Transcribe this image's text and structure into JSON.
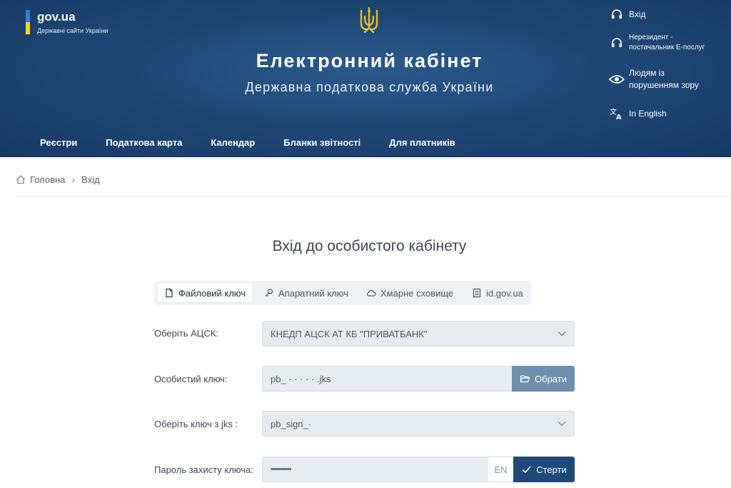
{
  "header": {
    "gov_brand": "gov.ua",
    "gov_subtitle": "Державні сайти України",
    "title": "Електронний кабінет",
    "subtitle": "Державна податкова служба України",
    "right_links": {
      "login": "Вхід",
      "nonresident_line1": "Нерезидент -",
      "nonresident_line2": "постачальник Е-послуг",
      "vision_line1": "Людям із",
      "vision_line2": "порушенням зору",
      "english": "In English"
    },
    "nav": [
      "Реєстри",
      "Податкова карта",
      "Календар",
      "Бланки звітності",
      "Для платників"
    ]
  },
  "breadcrumb": {
    "home": "Головна",
    "current": "Вхід"
  },
  "page_title": "Вхід до особистого кабінету",
  "tabs": [
    "Файловий ключ",
    "Апаратний ключ",
    "Хмарне сховище",
    "id.gov.ua"
  ],
  "form": {
    "acsk_label": "Оберіть АЦСК:",
    "acsk_value": "КНЕДП АЦСК АТ КБ \"ПРИВАТБАНК\"",
    "key_label": "Особистий ключ:",
    "key_value": "pb_  ·  ·    ·   ·  ·  .jks",
    "choose_btn": "Обрати",
    "jks_label": "Оберіть ключ з jks :",
    "jks_value": "pb_sign_·",
    "password_label": "Пароль захисту ключа:",
    "password_value": "••••••••••",
    "lang": "EN",
    "clear_btn": "Стерти"
  },
  "colors": {
    "header_bg": "#1f4776",
    "flag_blue": "#3a7bd5",
    "flag_yellow": "#f7d51e",
    "trident": "#e6c02b",
    "btn_dark": "#1e4a7a",
    "btn_muted": "#6f8fae"
  }
}
